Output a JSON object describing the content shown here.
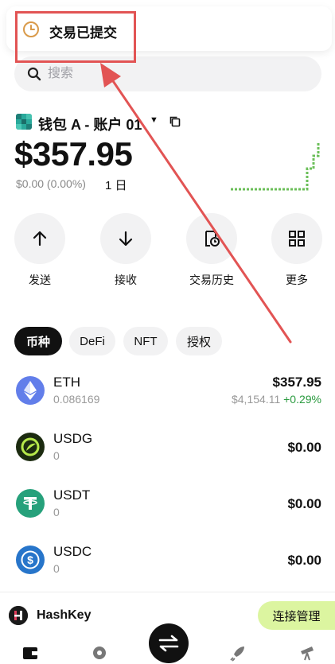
{
  "toast": {
    "text": "交易已提交",
    "icon": "clock-icon"
  },
  "search": {
    "placeholder": "搜索"
  },
  "wallet": {
    "name": "钱包 A - 账户 01",
    "balance": "$357.95",
    "change": "$0.00 (0.00%)",
    "period": "1 日"
  },
  "actions": [
    {
      "label": "发送",
      "icon": "arrow-up-icon"
    },
    {
      "label": "接收",
      "icon": "arrow-down-icon"
    },
    {
      "label": "交易历史",
      "icon": "history-icon"
    },
    {
      "label": "更多",
      "icon": "grid-icon"
    }
  ],
  "tabs": [
    {
      "label": "币种",
      "active": true
    },
    {
      "label": "DeFi",
      "active": false
    },
    {
      "label": "NFT",
      "active": false
    },
    {
      "label": "授权",
      "active": false
    }
  ],
  "tokens": [
    {
      "symbol": "ETH",
      "amount": "0.086169",
      "value": "$357.95",
      "price": "$4,154.11",
      "change": "+0.29%",
      "color": "#627eea",
      "icon": "eth-icon"
    },
    {
      "symbol": "USDG",
      "amount": "0",
      "value": "$0.00",
      "color": "#1c2b10",
      "icon": "usdg-icon"
    },
    {
      "symbol": "USDT",
      "amount": "0",
      "value": "$0.00",
      "color": "#26a17b",
      "icon": "usdt-icon"
    },
    {
      "symbol": "USDC",
      "amount": "0",
      "value": "$0.00",
      "color": "#2775ca",
      "icon": "usdc-icon"
    }
  ],
  "footer": {
    "dapp_name": "HashKey",
    "connect_label": "连接管理"
  },
  "colors": {
    "accent_green": "#2a9a3f",
    "highlight_red": "#e25454",
    "connect_bg": "#dcf5a0"
  }
}
